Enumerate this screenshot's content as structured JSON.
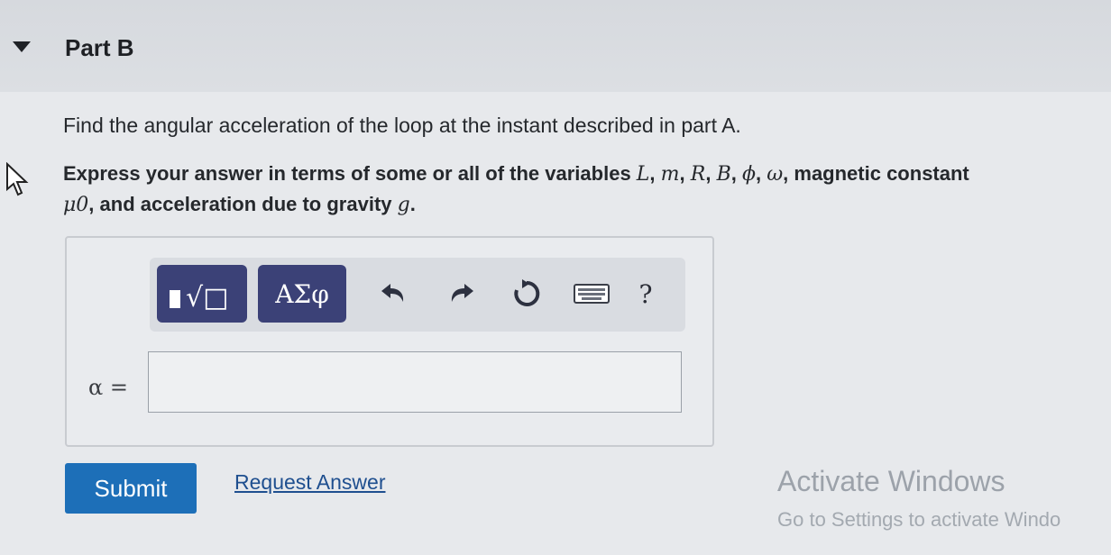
{
  "part": {
    "title": "Part B"
  },
  "question": {
    "text": "Find the angular acceleration of the loop at the instant described in part A."
  },
  "instructions": {
    "prefix": "Express your answer in terms of some or all of the variables ",
    "variables": [
      "L",
      "m",
      "R",
      "B",
      "ϕ",
      "ω"
    ],
    "middle": ", magnetic constant ",
    "constant": "μ0",
    "suffix": ", and acceleration due to gravity ",
    "gravity": "g",
    "end": "."
  },
  "toolbar": {
    "templates_label": "√□",
    "greek_label": "ΑΣφ",
    "help_label": "?"
  },
  "answer": {
    "variable_label": "α =",
    "value": ""
  },
  "actions": {
    "submit_label": "Submit",
    "request_label": "Request Answer"
  },
  "watermark": {
    "title": "Activate Windows",
    "subtitle": "Go to Settings to activate Windo"
  },
  "colors": {
    "submit": "#1d6fb8",
    "toolbar_button": "#3b4177",
    "link": "#1f4f8f"
  }
}
